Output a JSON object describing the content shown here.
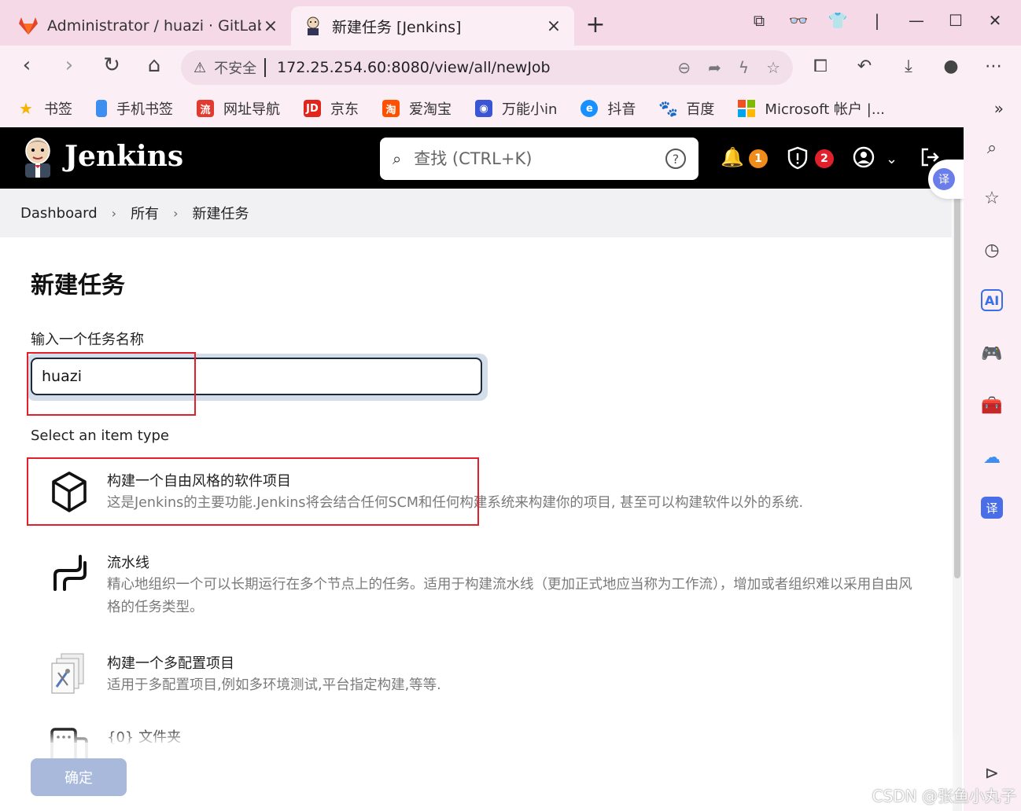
{
  "browser": {
    "tabs": [
      {
        "title": "Administrator / huazi · GitLab",
        "close": "×"
      },
      {
        "title": "新建任务 [Jenkins]",
        "close": "×"
      }
    ],
    "new_tab": "+",
    "address": {
      "insecure_label": "不安全",
      "url": "172.25.254.60:8080/view/all/newJob"
    },
    "bookmarks": [
      {
        "label": "书签",
        "color": "#f5b400"
      },
      {
        "label": "手机书签",
        "color": "#3d8ef0"
      },
      {
        "label": "网址导航",
        "color": "#e23a2e"
      },
      {
        "label": "京东",
        "color": "#e1251b"
      },
      {
        "label": "爱淘宝",
        "color": "#ff5000"
      },
      {
        "label": "万能小in",
        "color": "#3a56d4"
      },
      {
        "label": "抖音",
        "color": "#1890ff"
      },
      {
        "label": "百度",
        "color": "#2932e1"
      },
      {
        "label": "Microsoft 帐户 |...",
        "color": "#f25022"
      }
    ],
    "bookmarks_more": "»"
  },
  "jenkins": {
    "brand": "Jenkins",
    "search_placeholder": "查找 (CTRL+K)",
    "notifications_count": "1",
    "security_count": "2",
    "colors": {
      "header": "#000000",
      "notif_badge": "#f08c1c",
      "security_badge": "#e0202a"
    }
  },
  "breadcrumb": [
    "Dashboard",
    "所有",
    "新建任务"
  ],
  "page": {
    "title": "新建任务",
    "name_label": "输入一个任务名称",
    "name_value": "huazi",
    "type_label": "Select an item type",
    "items": [
      {
        "title": "构建一个自由风格的软件项目",
        "desc": "这是Jenkins的主要功能.Jenkins将会结合任何SCM和任何构建系统来构建你的项目, 甚至可以构建软件以外的系统."
      },
      {
        "title": "流水线",
        "desc": "精心地组织一个可以长期运行在多个节点上的任务。适用于构建流水线（更加正式地应当称为工作流），增加或者组织难以采用自由风格的任务类型。"
      },
      {
        "title": "构建一个多配置项目",
        "desc": "适用于多配置项目,例如多环境测试,平台指定构建,等等."
      },
      {
        "title": "{0} 文件夹",
        "desc": ""
      }
    ],
    "ok_button": "确定"
  },
  "sidebar_ai_label": "AI",
  "translate_label": "译",
  "watermark": "CSDN @张鱼小丸子"
}
